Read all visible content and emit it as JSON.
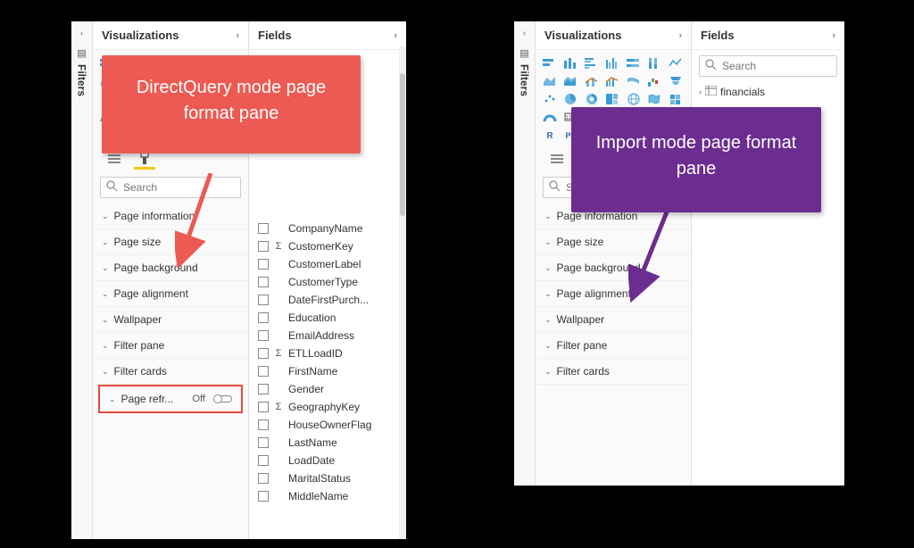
{
  "filters_label": "Filters",
  "left": {
    "viz_header": "Visualizations",
    "fields_header": "Fields",
    "search_placeholder": "Search",
    "format_sections": [
      {
        "label": "Page information"
      },
      {
        "label": "Page size"
      },
      {
        "label": "Page background"
      },
      {
        "label": "Page alignment"
      },
      {
        "label": "Wallpaper"
      },
      {
        "label": "Filter pane"
      },
      {
        "label": "Filter cards"
      }
    ],
    "page_refresh": {
      "label": "Page refr...",
      "state": "Off"
    },
    "fields": [
      {
        "name": "CompanyName",
        "sum": false
      },
      {
        "name": "CustomerKey",
        "sum": true
      },
      {
        "name": "CustomerLabel",
        "sum": false
      },
      {
        "name": "CustomerType",
        "sum": false
      },
      {
        "name": "DateFirstPurch...",
        "sum": false
      },
      {
        "name": "Education",
        "sum": false
      },
      {
        "name": "EmailAddress",
        "sum": false
      },
      {
        "name": "ETLLoadID",
        "sum": true
      },
      {
        "name": "FirstName",
        "sum": false
      },
      {
        "name": "Gender",
        "sum": false
      },
      {
        "name": "GeographyKey",
        "sum": true
      },
      {
        "name": "HouseOwnerFlag",
        "sum": false
      },
      {
        "name": "LastName",
        "sum": false
      },
      {
        "name": "LoadDate",
        "sum": false
      },
      {
        "name": "MaritalStatus",
        "sum": false
      },
      {
        "name": "MiddleName",
        "sum": false
      }
    ]
  },
  "right": {
    "viz_header": "Visualizations",
    "fields_header": "Fields",
    "search_placeholder": "Search",
    "table_name": "financials",
    "format_sections": [
      {
        "label": "Page information"
      },
      {
        "label": "Page size"
      },
      {
        "label": "Page background"
      },
      {
        "label": "Page alignment"
      },
      {
        "label": "Wallpaper"
      },
      {
        "label": "Filter pane"
      },
      {
        "label": "Filter cards"
      }
    ]
  },
  "callout_left": "DirectQuery mode page format pane",
  "callout_right": "Import mode page format pane",
  "colors": {
    "red": "#ec5a53",
    "purple": "#6b2d90",
    "yellow": "#f2c811"
  }
}
